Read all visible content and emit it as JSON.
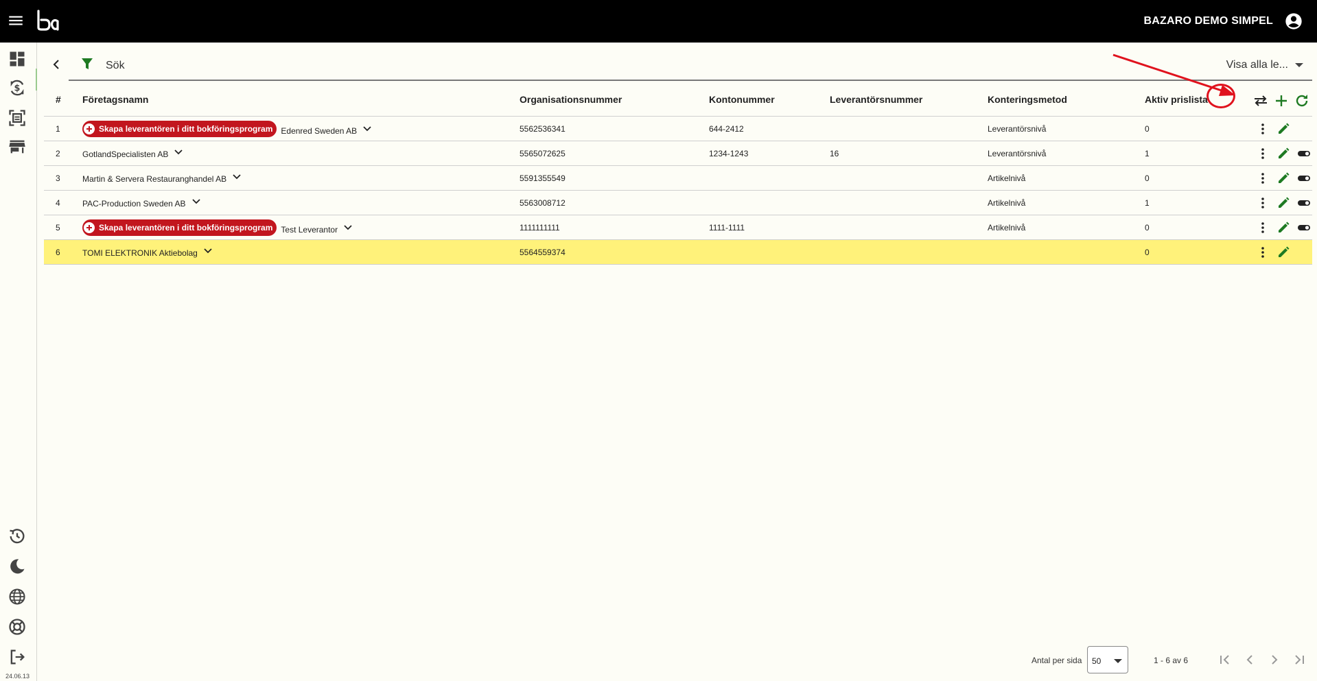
{
  "header": {
    "company_name": "BAZARO DEMO SIMPEL",
    "icons": [
      "menu-icon",
      "logo",
      "account-circle-icon"
    ]
  },
  "sidenav": {
    "top_items": [
      "dashboard-icon",
      "currency-exchange-icon",
      "document-scan-icon",
      "store-icon"
    ],
    "bottom_items": [
      "history-icon",
      "dark-mode-icon",
      "language-globe-icon",
      "support-icon",
      "logout-icon"
    ],
    "version": "24.06.13"
  },
  "toolbar": {
    "search_placeholder": "Sök",
    "view_filter": "Visa alla le..."
  },
  "table": {
    "columns": [
      "#",
      "Företagsnamn",
      "Organisationsnummer",
      "Kontonummer",
      "Leverantörsnummer",
      "Konteringsmetod",
      "Aktiv prislista"
    ],
    "header_actions": [
      "swap-horiz-icon",
      "add-icon",
      "refresh-icon"
    ],
    "chip_label": "Skapa leverantören i ditt bokföringsprogram",
    "rows": [
      {
        "num": "1",
        "name": "Edenred Sweden AB",
        "org": "5562536341",
        "account": "644-2412",
        "supplier_no": "",
        "method": "Leverantörsnivå",
        "pricelist": "0",
        "chip": true,
        "toggle": false,
        "highlight": false
      },
      {
        "num": "2",
        "name": "GotlandSpecialisten AB",
        "org": "5565072625",
        "account": "1234-1243",
        "supplier_no": "16",
        "method": "Leverantörsnivå",
        "pricelist": "1",
        "chip": false,
        "toggle": true,
        "highlight": false
      },
      {
        "num": "3",
        "name": "Martin & Servera Restauranghandel AB",
        "org": "5591355549",
        "account": "",
        "supplier_no": "",
        "method": "Artikelnivå",
        "pricelist": "0",
        "chip": false,
        "toggle": true,
        "highlight": false
      },
      {
        "num": "4",
        "name": "PAC-Production Sweden AB",
        "org": "5563008712",
        "account": "",
        "supplier_no": "",
        "method": "Artikelnivå",
        "pricelist": "1",
        "chip": false,
        "toggle": true,
        "highlight": false
      },
      {
        "num": "5",
        "name": "Test Leverantor",
        "org": "1111111111",
        "account": "1111-1111",
        "supplier_no": "",
        "method": "Artikelnivå",
        "pricelist": "0",
        "chip": true,
        "toggle": true,
        "highlight": false
      },
      {
        "num": "6",
        "name": "TOMI ELEKTRONIK Aktiebolag",
        "org": "5564559374",
        "account": "",
        "supplier_no": "",
        "method": "",
        "pricelist": "0",
        "chip": false,
        "toggle": false,
        "highlight": true
      }
    ]
  },
  "pagination": {
    "per_page_label": "Antal per sida",
    "per_page_value": "50",
    "range_text": "1 - 6 av 6"
  },
  "colors": {
    "topbar": "#000000",
    "accent_green": "#1e7a22",
    "chip_red": "#c2161e",
    "highlight_row": "#fff27a",
    "annotation_red": "#e0121d"
  }
}
